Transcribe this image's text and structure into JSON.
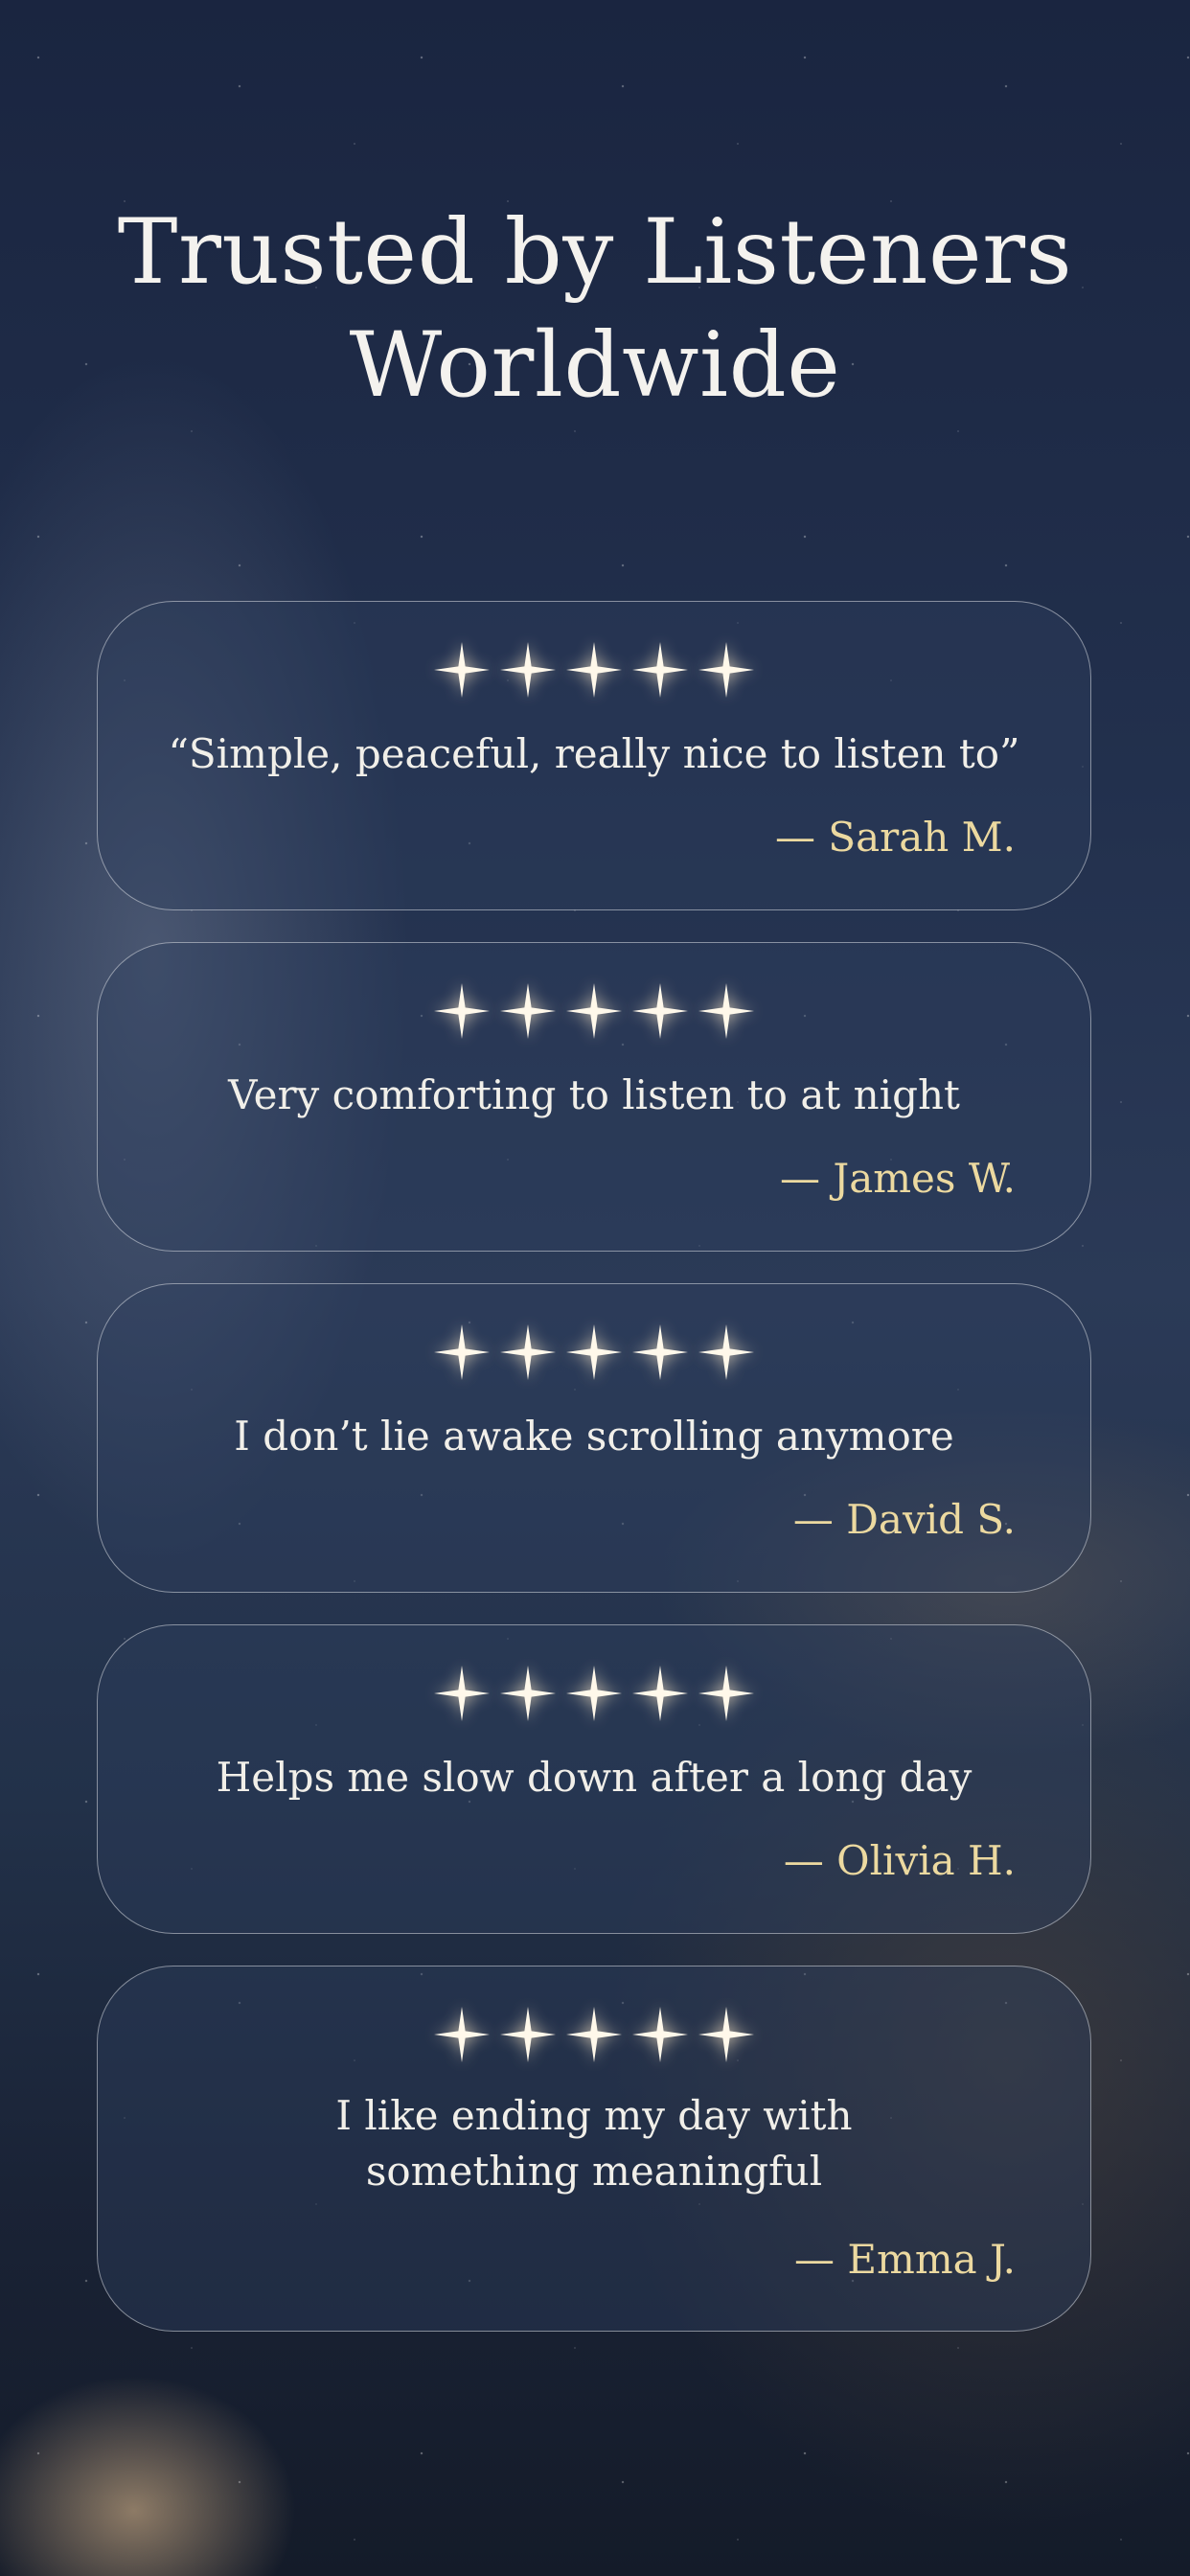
{
  "header": {
    "title_line1": "Trusted by Listeners",
    "title_line2": "Worldwide"
  },
  "star_icon": "sparkle-star-icon",
  "colors": {
    "title": "#f4f2ee",
    "quote": "#f1efe9",
    "author": "#ecd9a0",
    "card_border": "#ffffff"
  },
  "reviews": [
    {
      "rating": 5,
      "quote": "“Simple, peaceful,  really nice to listen to”",
      "author": "— Sarah M."
    },
    {
      "rating": 5,
      "quote": "Very comforting to listen to at night",
      "author": "— James W."
    },
    {
      "rating": 5,
      "quote": "I don’t lie awake scrolling anymore",
      "author": "— David S."
    },
    {
      "rating": 5,
      "quote": "Helps me slow down after a long day",
      "author": "— Olivia H."
    },
    {
      "rating": 5,
      "quote": "I like ending my day with something meaningful",
      "author": "— Emma J."
    }
  ]
}
